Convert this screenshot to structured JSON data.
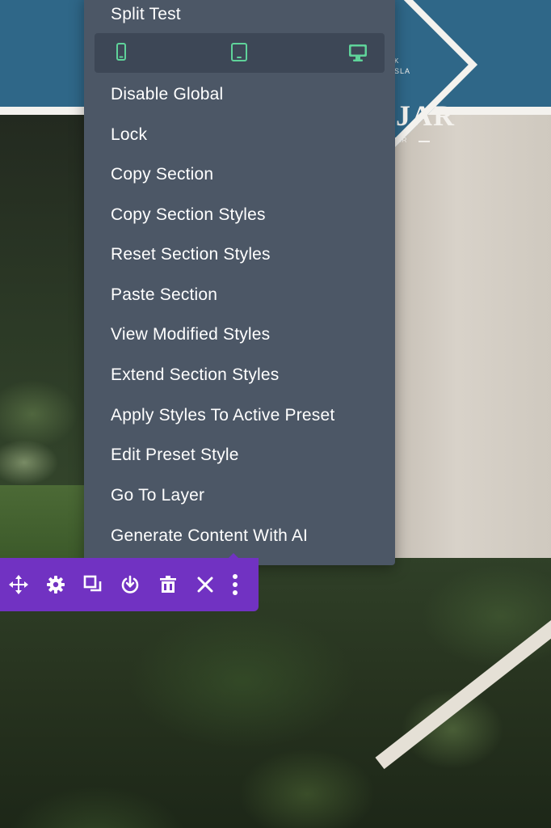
{
  "menu": {
    "items": [
      {
        "label": "Split Test"
      },
      {
        "label": "Disable Global"
      },
      {
        "label": "Lock"
      },
      {
        "label": "Copy Section"
      },
      {
        "label": "Copy Section Styles"
      },
      {
        "label": "Reset Section Styles"
      },
      {
        "label": "Paste Section"
      },
      {
        "label": "View Modified Styles"
      },
      {
        "label": "Extend Section Styles"
      },
      {
        "label": "Apply Styles To Active Preset"
      },
      {
        "label": "Edit Preset Style"
      },
      {
        "label": "Go To Layer"
      },
      {
        "label": "Generate Content With AI"
      }
    ],
    "device_toggles": [
      {
        "icon": "phone-icon"
      },
      {
        "icon": "tablet-icon"
      },
      {
        "icon": "desktop-icon"
      }
    ],
    "accent_color": "#5fd39a"
  },
  "logo": {
    "main": "JAR",
    "top_line_1": "K",
    "top_line_2": "SLA",
    "bottom_line": "TAR"
  },
  "toolbar": {
    "color": "#7132c2",
    "buttons": [
      {
        "icon": "move-icon"
      },
      {
        "icon": "gear-icon"
      },
      {
        "icon": "duplicate-icon"
      },
      {
        "icon": "save-to-library-icon"
      },
      {
        "icon": "trash-icon"
      },
      {
        "icon": "close-icon"
      },
      {
        "icon": "more-options-icon"
      }
    ]
  }
}
